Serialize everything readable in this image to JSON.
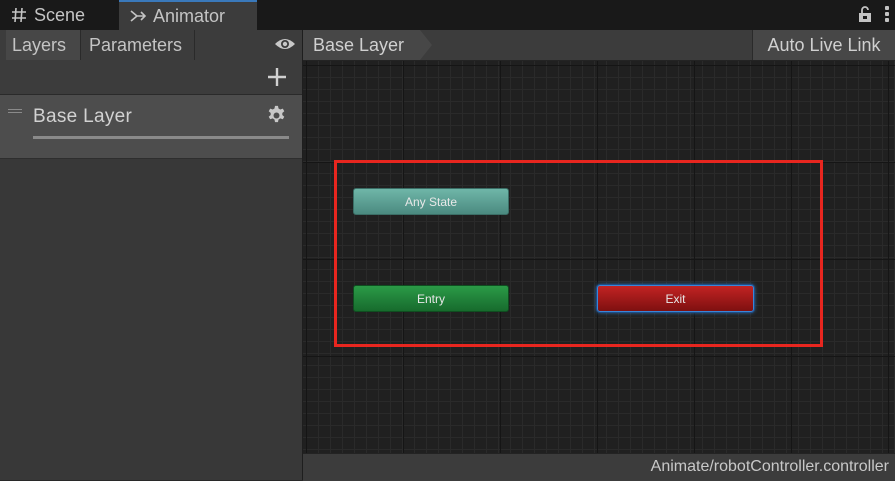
{
  "tabs": [
    {
      "label": "Scene",
      "icon": "hash-icon"
    },
    {
      "label": "Animator",
      "icon": "animator-icon"
    }
  ],
  "left_panel": {
    "tabs": [
      {
        "label": "Layers"
      },
      {
        "label": "Parameters"
      }
    ],
    "layers": [
      {
        "name": "Base Layer"
      }
    ]
  },
  "graph": {
    "breadcrumb": "Base Layer",
    "auto_live_link": "Auto Live Link",
    "nodes": {
      "any_state": "Any State",
      "entry": "Entry",
      "exit": "Exit"
    },
    "node_colors": {
      "any_state": "#5aa196",
      "entry": "#1e8037",
      "exit": "#a11a1a"
    },
    "highlight_color": "#e8261f"
  },
  "status": {
    "path": "Animate/robotController.controller"
  }
}
